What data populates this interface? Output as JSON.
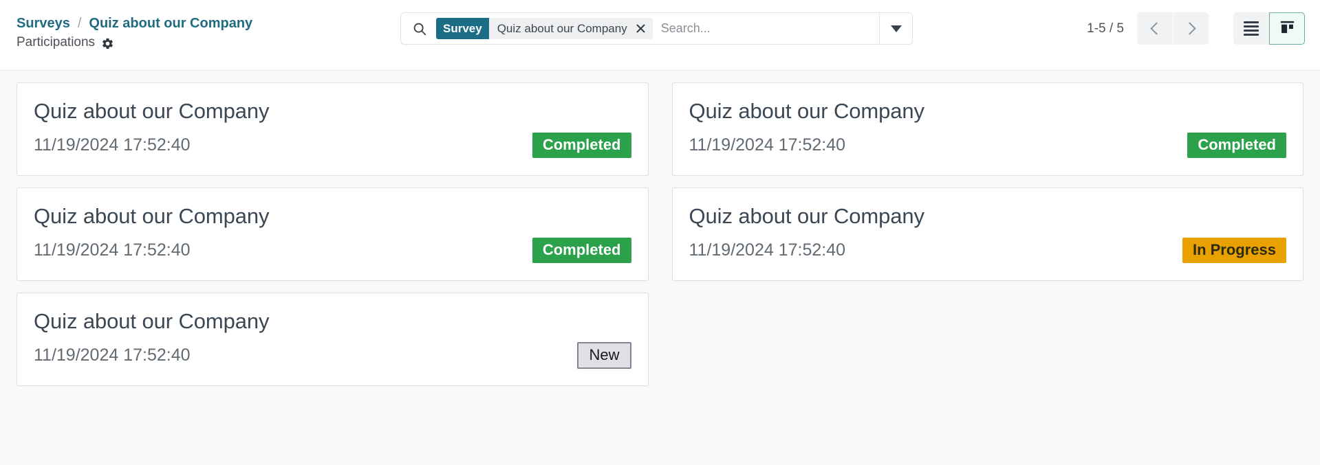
{
  "breadcrumb": {
    "parent": "Surveys",
    "separator": "/",
    "current": "Quiz about our Company",
    "subtitle": "Participations",
    "settings_icon": "gear-icon"
  },
  "search": {
    "search_icon": "search-icon",
    "facet_label": "Survey",
    "facet_value": "Quiz about our Company",
    "facet_remove_icon": "close-icon",
    "placeholder": "Search...",
    "value": "",
    "dropdown_icon": "caret-down-icon"
  },
  "pager": {
    "count": "1-5 / 5",
    "previous_icon": "chevron-left-icon",
    "next_icon": "chevron-right-icon"
  },
  "views": {
    "list_icon": "list-view-icon",
    "kanban_icon": "kanban-view-icon",
    "active": "kanban"
  },
  "colors": {
    "brand_teal": "#1b6d86",
    "breadcrumb_link": "#1f6b80",
    "badge_done": "#2aa14a",
    "badge_progress": "#e9a100",
    "badge_new_bg": "#dfdfe4",
    "badge_new_border": "#8d7f92",
    "card_bg": "#ffffff",
    "page_bg": "#f8f9fb",
    "active_view_border": "#6aa9a4"
  },
  "kanban": {
    "columns": [
      {
        "cards": [
          {
            "title": "Quiz about our Company",
            "date": "11/19/2024 17:52:40",
            "status": "Completed",
            "status_kind": "done"
          },
          {
            "title": "Quiz about our Company",
            "date": "11/19/2024 17:52:40",
            "status": "Completed",
            "status_kind": "done"
          },
          {
            "title": "Quiz about our Company",
            "date": "11/19/2024 17:52:40",
            "status": "New",
            "status_kind": "new"
          }
        ]
      },
      {
        "cards": [
          {
            "title": "Quiz about our Company",
            "date": "11/19/2024 17:52:40",
            "status": "Completed",
            "status_kind": "done"
          },
          {
            "title": "Quiz about our Company",
            "date": "11/19/2024 17:52:40",
            "status": "In Progress",
            "status_kind": "progress"
          }
        ]
      }
    ]
  }
}
